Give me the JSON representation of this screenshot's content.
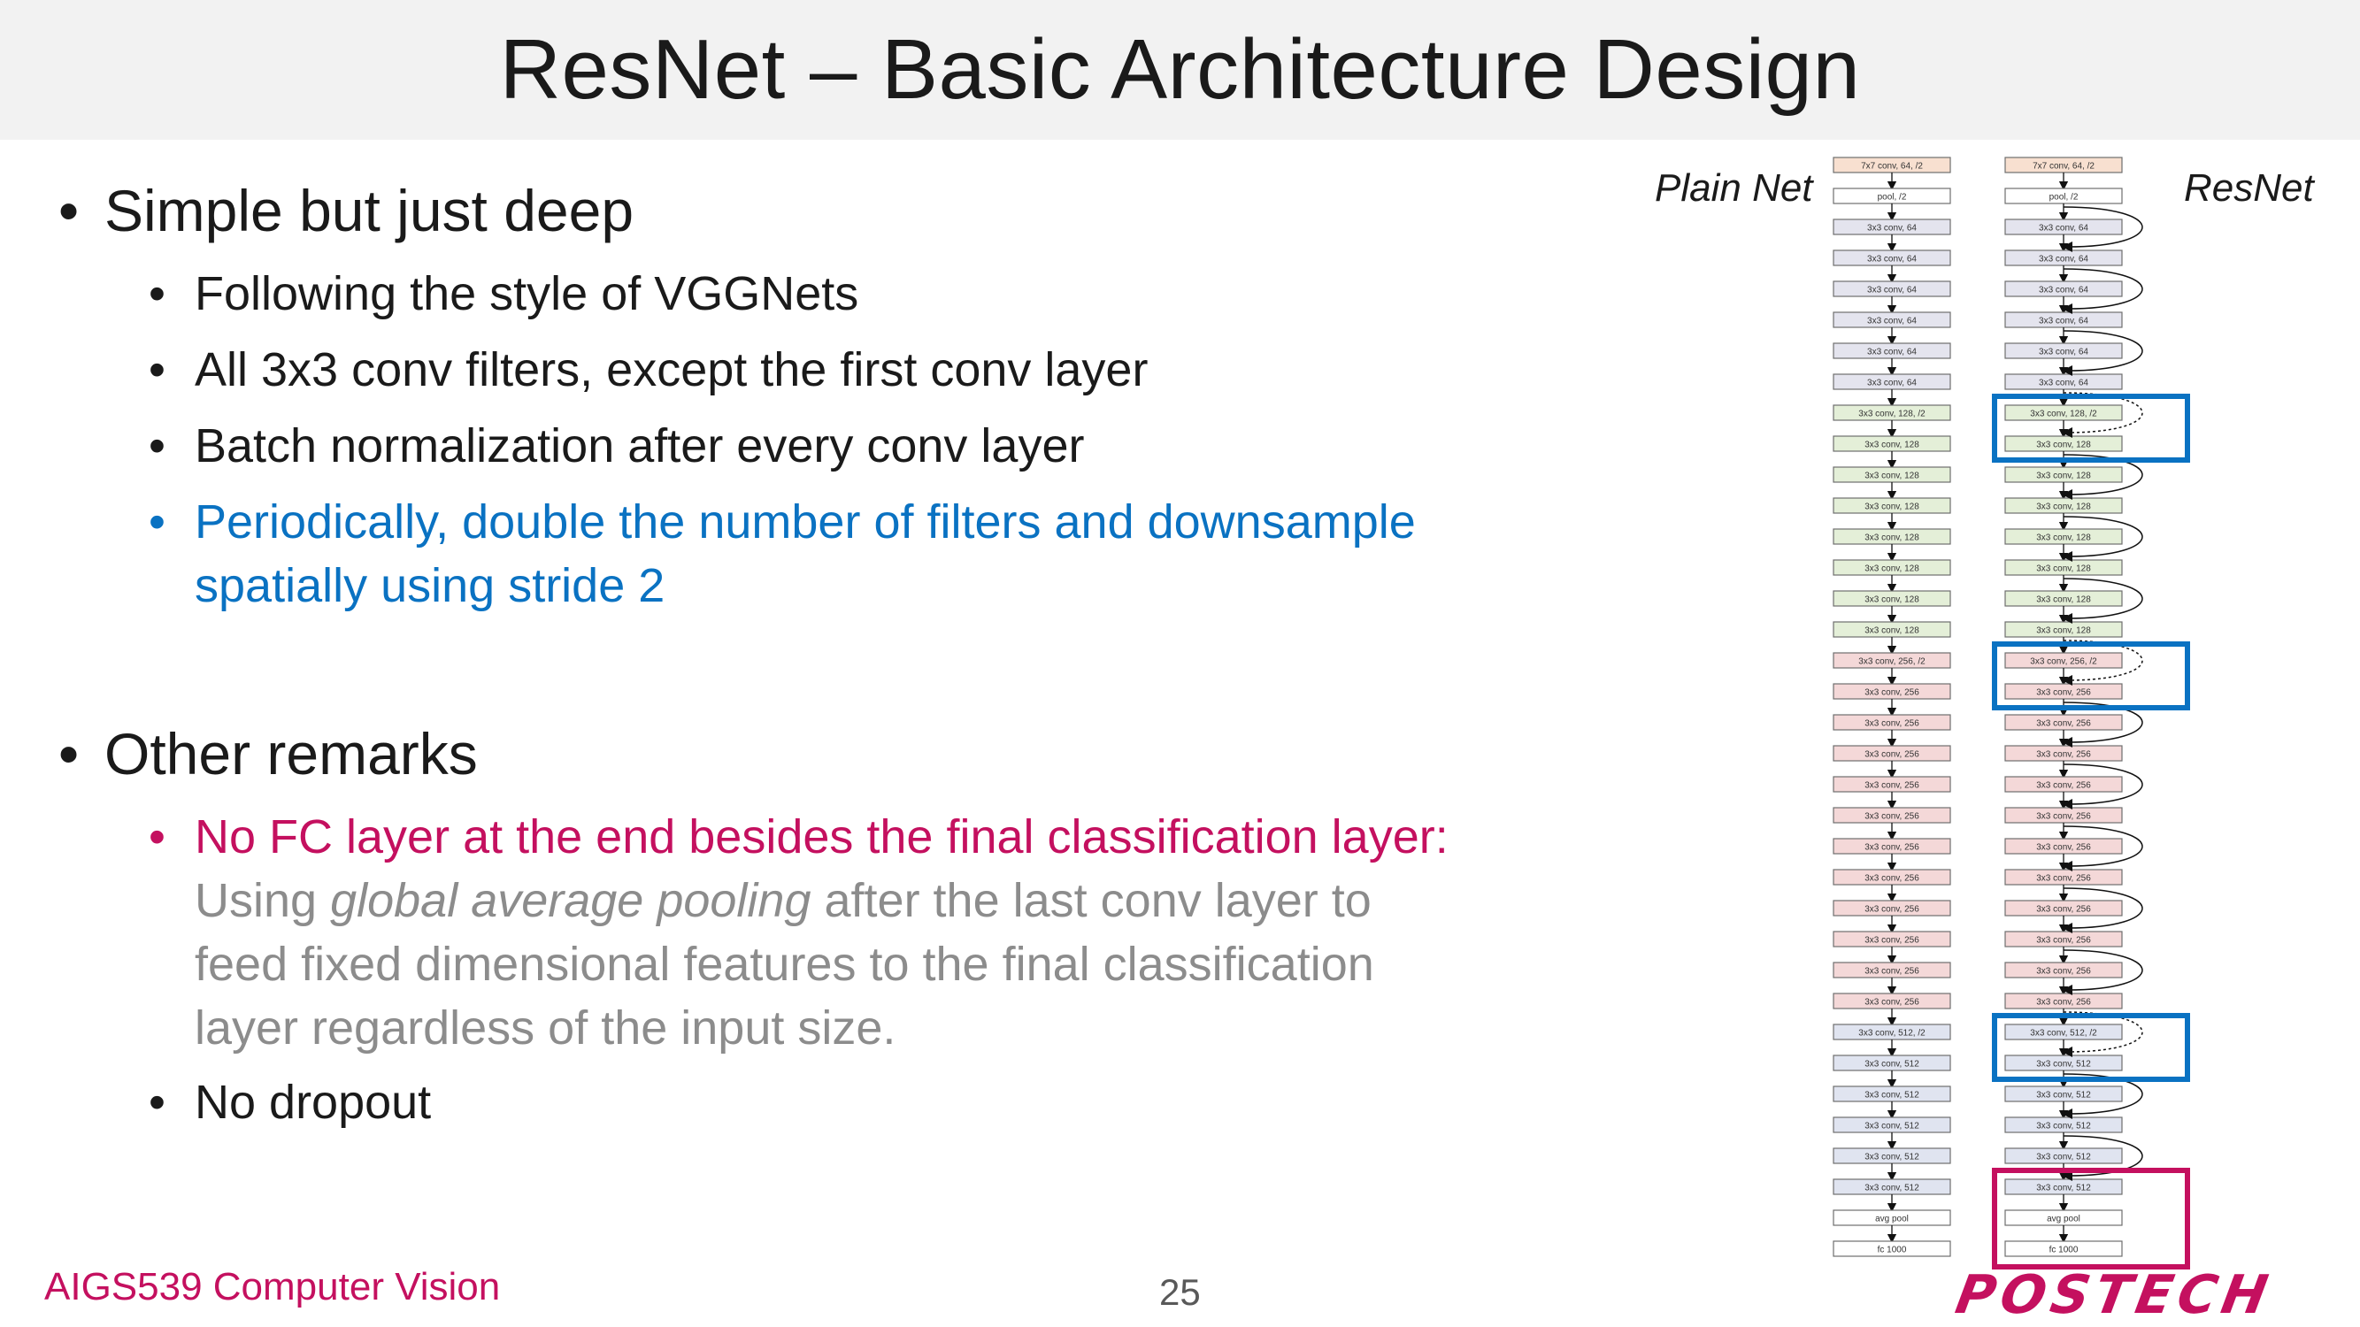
{
  "slide": {
    "title": "ResNet – Basic Architecture Design",
    "bullet1": {
      "text": "Simple but just deep",
      "sub": [
        "Following the style of VGGNets",
        "All 3x3 conv filters, except the first conv layer",
        "Batch normalization after every conv layer"
      ],
      "sub_blue_line1": "Periodically, double the number of filters and downsample",
      "sub_blue_line2": "spatially using stride 2"
    },
    "bullet2": {
      "text": "Other remarks",
      "sub_pink": "No FC layer at the end besides the final classification layer:",
      "sub_gray_lines": {
        "pre": "Using ",
        "italic": "global average pooling",
        "post": " after the last conv layer to",
        "line2": "feed fixed dimensional features to the final classification",
        "line3": "layer regardless of the input size."
      },
      "sub_last": "No dropout"
    },
    "diagram": {
      "plain_label": "Plain Net",
      "res_label": "ResNet",
      "layers": [
        {
          "label": "7x7 conv, 64, /2",
          "group": "first"
        },
        {
          "label": "pool, /2",
          "group": "pool"
        },
        {
          "label": "3x3 conv, 64",
          "group": "64"
        },
        {
          "label": "3x3 conv, 64",
          "group": "64"
        },
        {
          "label": "3x3 conv, 64",
          "group": "64"
        },
        {
          "label": "3x3 conv, 64",
          "group": "64"
        },
        {
          "label": "3x3 conv, 64",
          "group": "64"
        },
        {
          "label": "3x3 conv, 64",
          "group": "64"
        },
        {
          "label": "3x3 conv, 128, /2",
          "group": "128"
        },
        {
          "label": "3x3 conv, 128",
          "group": "128"
        },
        {
          "label": "3x3 conv, 128",
          "group": "128"
        },
        {
          "label": "3x3 conv, 128",
          "group": "128"
        },
        {
          "label": "3x3 conv, 128",
          "group": "128"
        },
        {
          "label": "3x3 conv, 128",
          "group": "128"
        },
        {
          "label": "3x3 conv, 128",
          "group": "128"
        },
        {
          "label": "3x3 conv, 128",
          "group": "128"
        },
        {
          "label": "3x3 conv, 256, /2",
          "group": "256"
        },
        {
          "label": "3x3 conv, 256",
          "group": "256"
        },
        {
          "label": "3x3 conv, 256",
          "group": "256"
        },
        {
          "label": "3x3 conv, 256",
          "group": "256"
        },
        {
          "label": "3x3 conv, 256",
          "group": "256"
        },
        {
          "label": "3x3 conv, 256",
          "group": "256"
        },
        {
          "label": "3x3 conv, 256",
          "group": "256"
        },
        {
          "label": "3x3 conv, 256",
          "group": "256"
        },
        {
          "label": "3x3 conv, 256",
          "group": "256"
        },
        {
          "label": "3x3 conv, 256",
          "group": "256"
        },
        {
          "label": "3x3 conv, 256",
          "group": "256"
        },
        {
          "label": "3x3 conv, 256",
          "group": "256"
        },
        {
          "label": "3x3 conv, 512, /2",
          "group": "512"
        },
        {
          "label": "3x3 conv, 512",
          "group": "512"
        },
        {
          "label": "3x3 conv, 512",
          "group": "512"
        },
        {
          "label": "3x3 conv, 512",
          "group": "512"
        },
        {
          "label": "3x3 conv, 512",
          "group": "512"
        },
        {
          "label": "3x3 conv, 512",
          "group": "512"
        },
        {
          "label": "avg pool",
          "group": "pool"
        },
        {
          "label": "fc 1000",
          "group": "fc"
        }
      ],
      "group_colors": {
        "first": "#f8e0d0",
        "pool": "#ffffff",
        "64": "#e4e4ee",
        "128": "#e4efd8",
        "256": "#f4d8d8",
        "512": "#e0e4f0",
        "fc": "#ffffff"
      },
      "highlight_blue": "#0a72c2",
      "highlight_pink": "#c4105f"
    },
    "footer": {
      "course": "AIGS539 Computer Vision",
      "page": "25",
      "logo_text": "POSTECH"
    }
  }
}
